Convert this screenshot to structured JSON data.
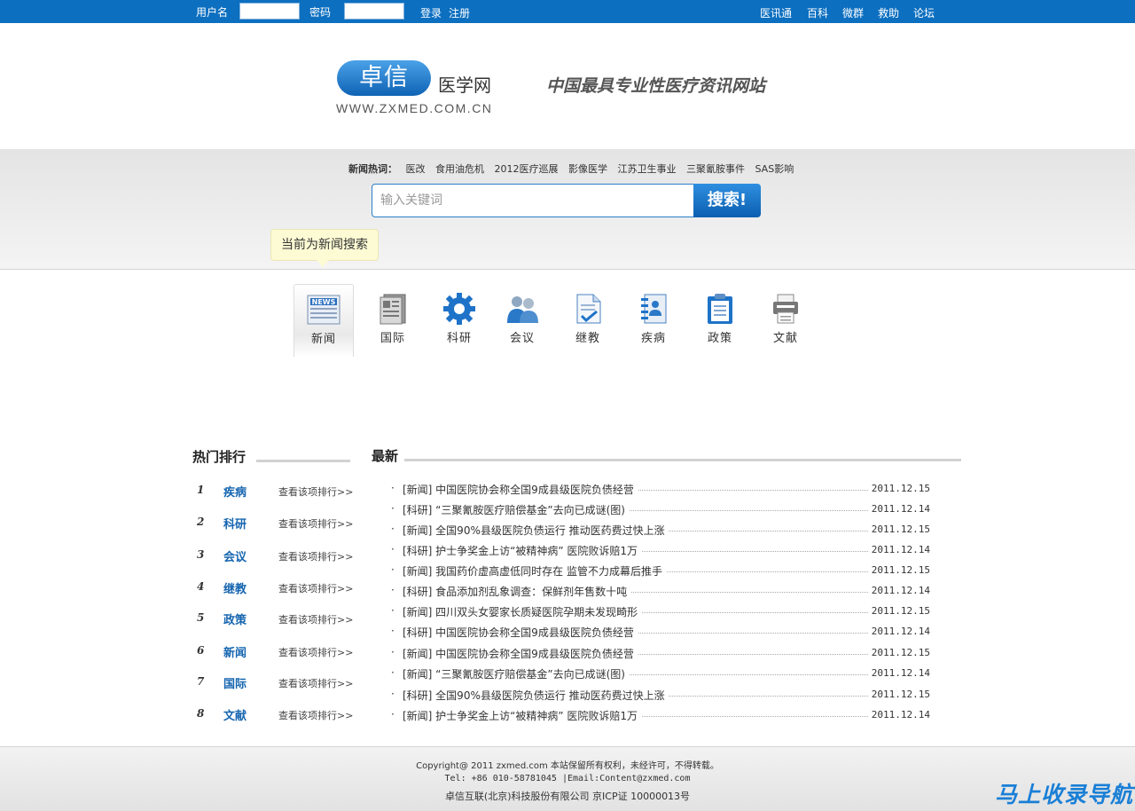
{
  "topbar": {
    "username_label": "用户名",
    "password_label": "密码",
    "login": "登录",
    "register": "注册",
    "right_links": [
      "医讯通",
      "百科",
      "微群",
      "救助",
      "论坛"
    ]
  },
  "header": {
    "logo_text": "卓信",
    "logo_cn": "医学网",
    "logo_url": "WWW.ZXMED.COM.CN",
    "slogan": "中国最具专业性医疗资讯网站"
  },
  "search": {
    "hot_title": "新闻热词：",
    "hot_words": [
      "医改",
      "食用油危机",
      "2012医疗巡展",
      "影像医学",
      "江苏卫生事业",
      "三聚氰胺事件",
      "SAS影响"
    ],
    "placeholder": "输入关键词",
    "button": "搜索!",
    "tip": "当前为新闻搜索"
  },
  "categories": [
    {
      "label": "新闻",
      "icon": "news-icon",
      "active": true
    },
    {
      "label": "国际",
      "icon": "newspaper-icon",
      "active": false
    },
    {
      "label": "科研",
      "icon": "gear-icon",
      "active": false
    },
    {
      "label": "会议",
      "icon": "people-icon",
      "active": false
    },
    {
      "label": "继教",
      "icon": "document-check-icon",
      "active": false
    },
    {
      "label": "疾病",
      "icon": "notebook-icon",
      "active": false
    },
    {
      "label": "政策",
      "icon": "clipboard-icon",
      "active": false
    },
    {
      "label": "文献",
      "icon": "printer-icon",
      "active": false
    }
  ],
  "ranking": {
    "title": "热门排行",
    "link_text": "查看该项排行>>",
    "items": [
      {
        "num": "1",
        "name": "疾病"
      },
      {
        "num": "2",
        "name": "科研"
      },
      {
        "num": "3",
        "name": "会议"
      },
      {
        "num": "4",
        "name": "继教"
      },
      {
        "num": "5",
        "name": "政策"
      },
      {
        "num": "6",
        "name": "新闻"
      },
      {
        "num": "7",
        "name": "国际"
      },
      {
        "num": "8",
        "name": "文献"
      }
    ]
  },
  "latest": {
    "title": "最新",
    "items": [
      {
        "title": "[新闻] 中国医院协会称全国9成县级医院负债经营",
        "date": "2011.12.15"
      },
      {
        "title": "[科研] “三聚氰胺医疗赔偿基金”去向已成谜(图)",
        "date": "2011.12.14"
      },
      {
        "title": "[新闻] 全国90%县级医院负债运行 推动医药费过快上涨",
        "date": "2011.12.15"
      },
      {
        "title": "[科研] 护士争奖金上访“被精神病” 医院败诉赔1万",
        "date": "2011.12.14"
      },
      {
        "title": "[新闻] 我国药价虚高虚低同时存在 监管不力成幕后推手",
        "date": "2011.12.15"
      },
      {
        "title": "[科研] 食品添加剂乱象调查：保鲜剂年售数十吨",
        "date": "2011.12.14"
      },
      {
        "title": "[新闻] 四川双头女婴家长质疑医院孕期未发现畸形",
        "date": "2011.12.15"
      },
      {
        "title": "[科研] 中国医院协会称全国9成县级医院负债经营",
        "date": "2011.12.14"
      },
      {
        "title": "[新闻] 中国医院协会称全国9成县级医院负债经营",
        "date": "2011.12.15"
      },
      {
        "title": "[新闻] “三聚氰胺医疗赔偿基金”去向已成谜(图)",
        "date": "2011.12.14"
      },
      {
        "title": "[科研] 全国90%县级医院负债运行 推动医药费过快上涨",
        "date": "2011.12.15"
      },
      {
        "title": "[新闻] 护士争奖金上访“被精神病” 医院败诉赔1万",
        "date": "2011.12.14"
      }
    ]
  },
  "footer": {
    "line1": "Copyright@ 2011 zxmed.com 本站保留所有权利，未经许可，不得转载。",
    "line2": "Tel: +86 010-58781045 |Email:Content@zxmed.com",
    "line3": "卓信互联(北京)科技股份有限公司  京ICP证 10000013号",
    "watermark": "马上收录导航"
  },
  "colors": {
    "brand_blue": "#0c6fc0",
    "link_blue": "#1565b0"
  }
}
